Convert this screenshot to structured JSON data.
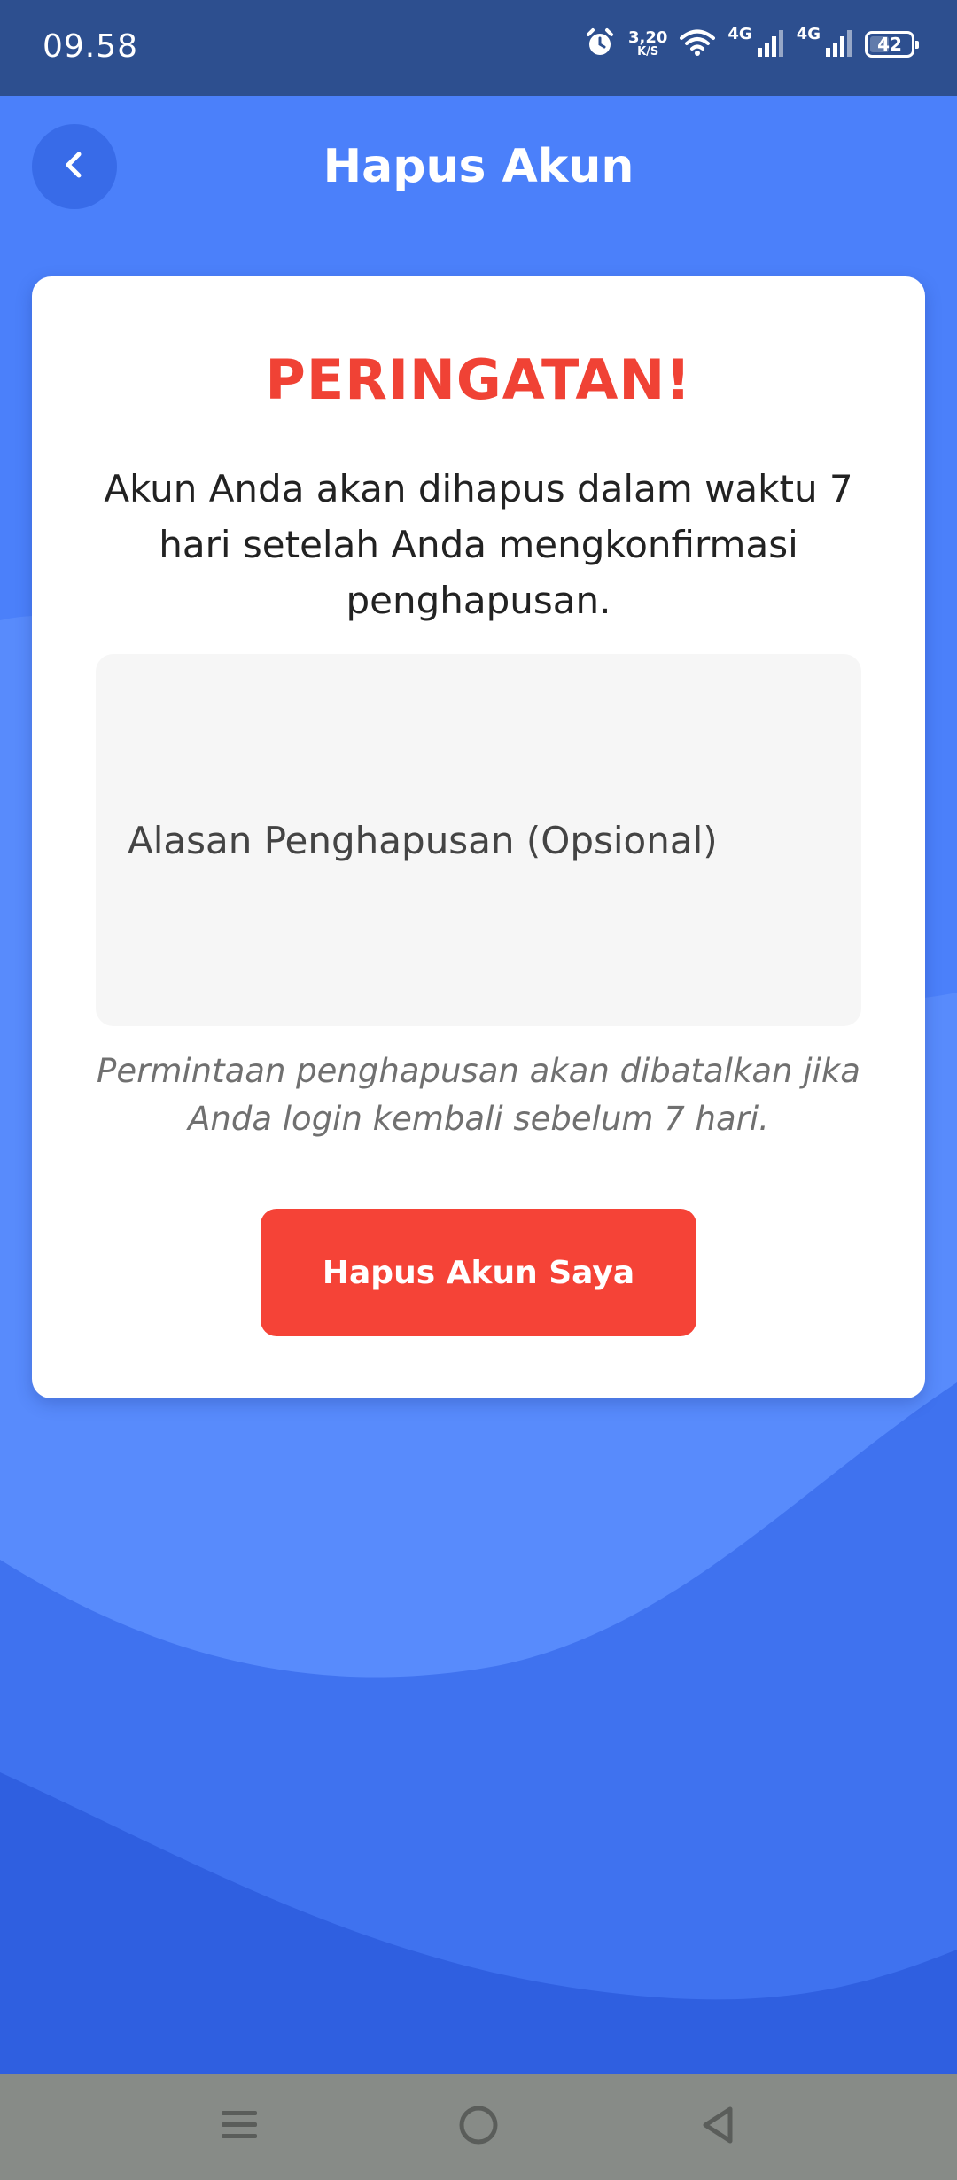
{
  "status_bar": {
    "time": "09.58",
    "net_speed_value": "3,20",
    "net_speed_unit": "K/S",
    "signal_1_label": "4G",
    "signal_2_label": "4G",
    "battery_level": "42"
  },
  "header": {
    "title": "Hapus Akun",
    "back_icon": "chevron-left-icon"
  },
  "card": {
    "warning_title": "PERINGATAN!",
    "warning_text": "Akun Anda akan dihapus dalam waktu 7 hari setelah Anda mengkonfirmasi penghapusan.",
    "reason_input": {
      "value": "",
      "placeholder": "Alasan Penghapusan (Opsional)"
    },
    "note": "Permintaan penghapusan akan dibatalkan jika Anda login kembali sebelum 7 hari.",
    "delete_button_label": "Hapus Akun Saya"
  },
  "nav_bar": {
    "icons": [
      "menu-icon",
      "home-circle-icon",
      "back-triangle-icon"
    ]
  },
  "colors": {
    "status_bar_bg": "#2d4f8f",
    "background_blue": "#4a7ef8",
    "warning_red": "#f04235",
    "button_red": "#f54337",
    "nav_bar_bg": "#878b87"
  }
}
